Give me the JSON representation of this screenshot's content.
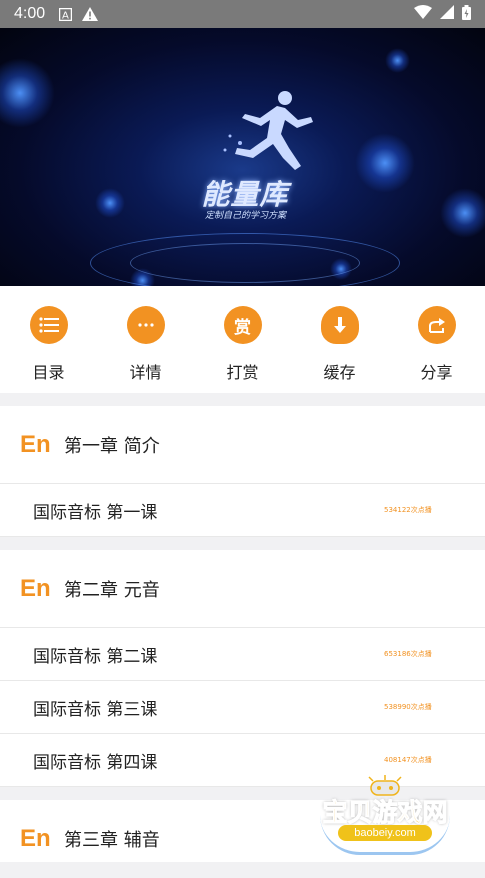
{
  "status_bar": {
    "time": "4:00"
  },
  "banner": {
    "logo_title": "能量库",
    "logo_subtitle": "定制自己的学习方案"
  },
  "actions": [
    {
      "label": "目录",
      "icon": "list-icon"
    },
    {
      "label": "详情",
      "icon": "more-dots-icon"
    },
    {
      "label": "打赏",
      "icon": "reward-icon"
    },
    {
      "label": "缓存",
      "icon": "cloud-download-icon"
    },
    {
      "label": "分享",
      "icon": "share-icon"
    }
  ],
  "chapters": [
    {
      "badge": "En",
      "title": "第一章 简介",
      "lessons": [
        {
          "title": "国际音标  第一课",
          "plays": "534122次点播"
        }
      ]
    },
    {
      "badge": "En",
      "title": "第二章 元音",
      "lessons": [
        {
          "title": "国际音标  第二课",
          "plays": "653186次点播"
        },
        {
          "title": "国际音标  第三课",
          "plays": "538990次点播"
        },
        {
          "title": "国际音标  第四课",
          "plays": "408147次点播"
        }
      ]
    },
    {
      "badge": "En",
      "title": "第三章 辅音",
      "lessons": []
    }
  ],
  "watermark": {
    "text": "宝贝游戏网",
    "url": "baobeiy.com"
  },
  "colors": {
    "accent": "#f29222",
    "status_bar": "#7a7a7a",
    "divider": "#f1f1f3"
  }
}
